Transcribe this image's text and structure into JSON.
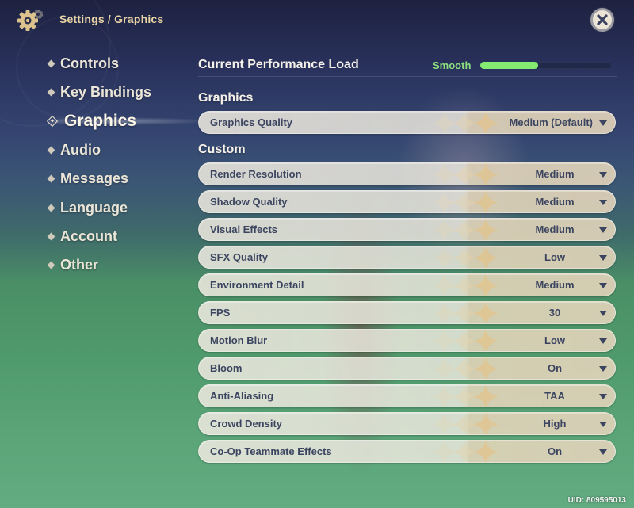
{
  "header": {
    "icon": "gear-icon",
    "breadcrumb": "Settings / Graphics",
    "close_icon": "close-icon"
  },
  "sidebar": {
    "items": [
      {
        "label": "Controls",
        "active": false
      },
      {
        "label": "Key Bindings",
        "active": false
      },
      {
        "label": "Graphics",
        "active": true
      },
      {
        "label": "Audio",
        "active": false
      },
      {
        "label": "Messages",
        "active": false
      },
      {
        "label": "Language",
        "active": false
      },
      {
        "label": "Account",
        "active": false
      },
      {
        "label": "Other",
        "active": false
      }
    ]
  },
  "performance": {
    "label": "Current Performance Load",
    "status": "Smooth",
    "load_percent": 44,
    "status_color": "#8de07e"
  },
  "graphics_section": {
    "title": "Graphics",
    "settings": [
      {
        "label": "Graphics Quality",
        "value": "Medium (Default)"
      }
    ]
  },
  "custom_section": {
    "title": "Custom",
    "settings": [
      {
        "label": "Render Resolution",
        "value": "Medium"
      },
      {
        "label": "Shadow Quality",
        "value": "Medium"
      },
      {
        "label": "Visual Effects",
        "value": "Medium"
      },
      {
        "label": "SFX Quality",
        "value": "Low"
      },
      {
        "label": "Environment Detail",
        "value": "Medium"
      },
      {
        "label": "FPS",
        "value": "30"
      },
      {
        "label": "Motion Blur",
        "value": "Low"
      },
      {
        "label": "Bloom",
        "value": "On"
      },
      {
        "label": "Anti-Aliasing",
        "value": "TAA"
      },
      {
        "label": "Crowd Density",
        "value": "High"
      },
      {
        "label": "Co-Op Teammate Effects",
        "value": "On"
      }
    ]
  },
  "footer": {
    "uid": "UID: 809595013"
  }
}
